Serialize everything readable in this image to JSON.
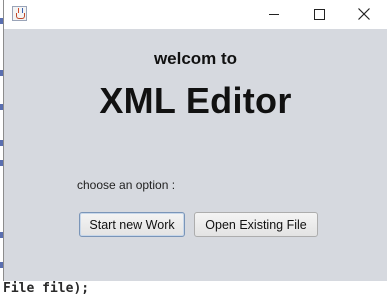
{
  "window": {
    "icon": "java-cup-icon",
    "controls": {
      "minimize": "minimize-icon",
      "maximize": "maximize-icon",
      "close": "close-icon"
    }
  },
  "content": {
    "welcome_text": "welcom to",
    "title": "XML Editor",
    "prompt": "choose an option :",
    "buttons": {
      "new_work": "Start new Work",
      "open_file": "Open Existing File"
    }
  },
  "background_editor": {
    "visible_code": "File file);"
  },
  "colors": {
    "dialog_background": "#d6d9df",
    "titlebar_background": "#ffffff",
    "focused_button_border": "#7a95b8"
  }
}
